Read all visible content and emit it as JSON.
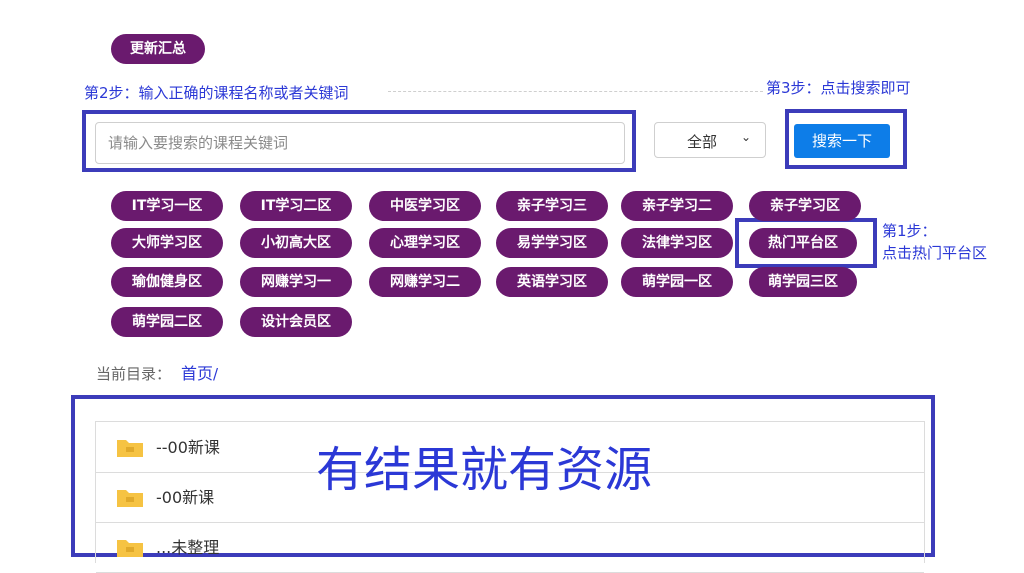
{
  "header": {
    "update_label": "更新汇总"
  },
  "annotations": {
    "step2": "第2步：输入正确的课程名称或者关键词",
    "step3": "第3步：点击搜索即可",
    "step1_line1": "第1步：",
    "step1_line2": "点击热门平台区",
    "result": "有结果就有资源"
  },
  "search": {
    "placeholder": "请输入要搜索的课程关键词",
    "select_value": "全部",
    "button_label": "搜索一下"
  },
  "categories": [
    "IT学习一区",
    "IT学习二区",
    "中医学习区",
    "亲子学习三",
    "亲子学习二",
    "亲子学习区",
    "大师学习区",
    "小初高大区",
    "心理学习区",
    "易学学习区",
    "法律学习区",
    "热门平台区",
    "瑜伽健身区",
    "网赚学习一",
    "网赚学习二",
    "英语学习区",
    "萌学园一区",
    "萌学园三区",
    "萌学园二区",
    "设计会员区"
  ],
  "breadcrumb": {
    "label": "当前目录：",
    "home": "首页",
    "separator": "/"
  },
  "files": [
    {
      "name": "--00新课"
    },
    {
      "name": "-00新课"
    },
    {
      "name": "...未整理"
    }
  ],
  "colors": {
    "pill": "#6a1a6e",
    "annotation": "#2b38d6",
    "box": "#3c3cba",
    "search_button": "#0d7de8",
    "folder": "#f6c343"
  }
}
